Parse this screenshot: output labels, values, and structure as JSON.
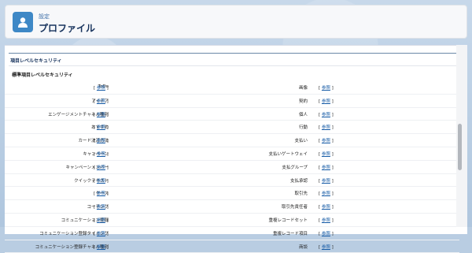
{
  "header": {
    "breadcrumb": "設定",
    "title": "プロファイル"
  },
  "section": {
    "title": "項目レベルセキュリティ",
    "subtitle": "標準項目レベルセキュリティ"
  },
  "rows": [
    {
      "left": "ToDo",
      "right": "画像"
    },
    {
      "left": "アイデア",
      "right": "契約"
    },
    {
      "left": "エンゲージメントチャネル種別",
      "right": "個人"
    },
    {
      "left": "おすすめ",
      "right": "行動"
    },
    {
      "left": "カード決済方法",
      "right": "支払い"
    },
    {
      "left": "キャンペーン",
      "right": "支払いゲートウェイ"
    },
    {
      "left": "キャンペーンメンバー",
      "right": "支払グループ"
    },
    {
      "left": "クイックテキスト",
      "right": "支払承認"
    },
    {
      "left": "ケース",
      "right": "取引先"
    },
    {
      "left": "コーチング",
      "right": "取引先責任者"
    },
    {
      "left": "コミュニケーション登録",
      "right": "重複レコードセット"
    },
    {
      "left": "コミュニケーション登録タイミング",
      "right": "重複レコード項目"
    },
    {
      "left": "コミュニケーション登録チャネル種別",
      "right": "商談"
    }
  ],
  "link": {
    "open": "[ ",
    "text": "参照",
    "close": " ]"
  },
  "colors": {
    "accent": "#3e88c6",
    "link": "#1a5ea8",
    "title": "#16325c"
  }
}
